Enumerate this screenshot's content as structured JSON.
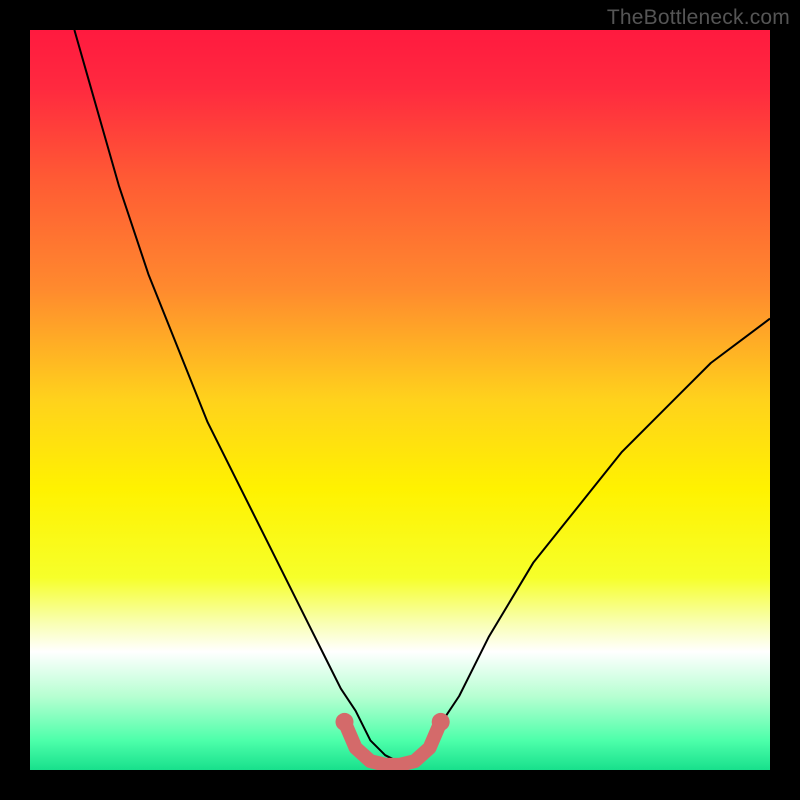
{
  "watermark": "TheBottleneck.com",
  "chart_data": {
    "type": "line",
    "title": "",
    "xlabel": "",
    "ylabel": "",
    "xlim": [
      0,
      100
    ],
    "ylim": [
      0,
      100
    ],
    "grid": false,
    "legend": false,
    "background_gradient": {
      "stops": [
        {
          "offset": 0.0,
          "color": "#ff1a3f"
        },
        {
          "offset": 0.08,
          "color": "#ff2a3f"
        },
        {
          "offset": 0.2,
          "color": "#ff5a34"
        },
        {
          "offset": 0.35,
          "color": "#ff8a2e"
        },
        {
          "offset": 0.5,
          "color": "#ffd21c"
        },
        {
          "offset": 0.62,
          "color": "#fff200"
        },
        {
          "offset": 0.74,
          "color": "#f6ff2a"
        },
        {
          "offset": 0.8,
          "color": "#f9ffb0"
        },
        {
          "offset": 0.84,
          "color": "#ffffff"
        },
        {
          "offset": 0.9,
          "color": "#b7ffd2"
        },
        {
          "offset": 0.96,
          "color": "#4dffaa"
        },
        {
          "offset": 1.0,
          "color": "#18e08c"
        }
      ]
    },
    "series": [
      {
        "name": "bottleneck-curve",
        "stroke": "#000000",
        "stroke_width": 2,
        "x": [
          6,
          8,
          10,
          12,
          14,
          16,
          18,
          20,
          22,
          24,
          26,
          28,
          30,
          32,
          34,
          36,
          38,
          40,
          42,
          44,
          46,
          48,
          50,
          52,
          54,
          56,
          58,
          60,
          62,
          65,
          68,
          72,
          76,
          80,
          84,
          88,
          92,
          96,
          100
        ],
        "y": [
          100,
          93,
          86,
          79,
          73,
          67,
          62,
          57,
          52,
          47,
          43,
          39,
          35,
          31,
          27,
          23,
          19,
          15,
          11,
          8,
          4,
          2,
          1,
          2,
          4,
          7,
          10,
          14,
          18,
          23,
          28,
          33,
          38,
          43,
          47,
          51,
          55,
          58,
          61
        ]
      },
      {
        "name": "sweet-spot-highlight",
        "stroke": "#d46a6a",
        "stroke_width": 14,
        "linecap": "round",
        "dots": true,
        "dot_radius": 9,
        "x": [
          42.5,
          44,
          46,
          48,
          50,
          52,
          54,
          55.5
        ],
        "y": [
          6.5,
          3,
          1.2,
          0.7,
          0.7,
          1.2,
          3,
          6.5
        ]
      }
    ]
  }
}
